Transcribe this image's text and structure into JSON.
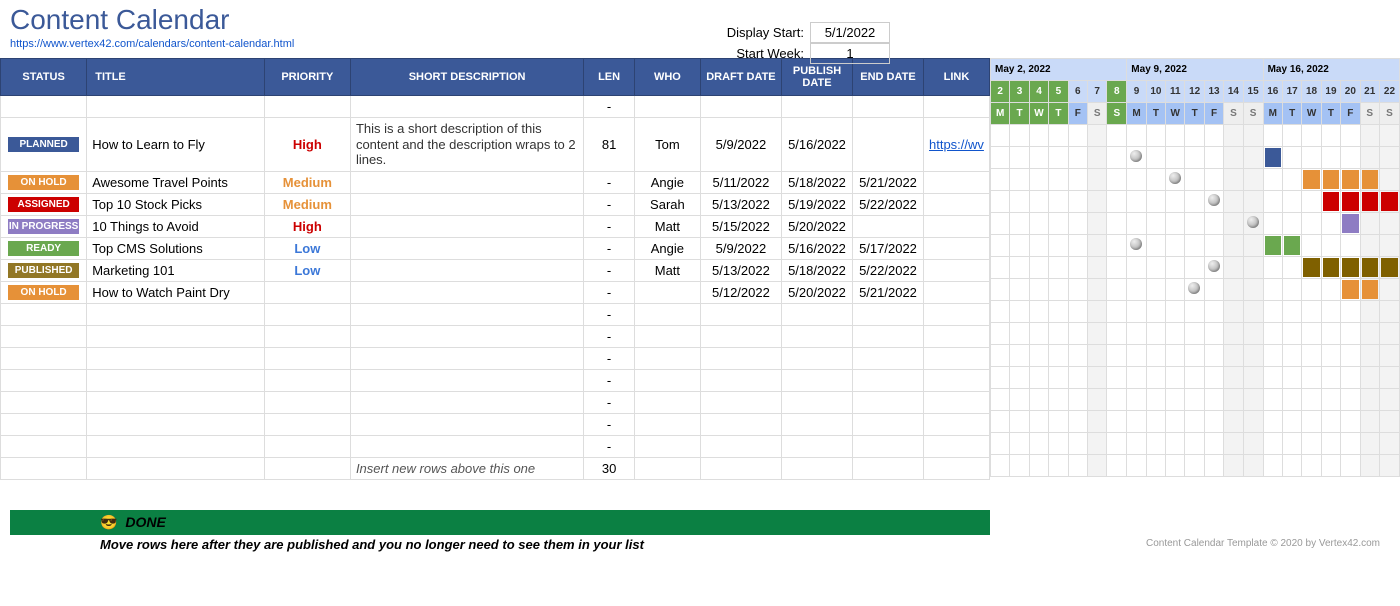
{
  "title": "Content Calendar",
  "source_url": "https://www.vertex42.com/calendars/content-calendar.html",
  "controls": {
    "display_start_label": "Display Start:",
    "display_start_value": "5/1/2022",
    "start_week_label": "Start Week:",
    "start_week_value": "1"
  },
  "columns": {
    "status": "STATUS",
    "title": "TITLE",
    "priority": "PRIORITY",
    "short_desc": "SHORT DESCRIPTION",
    "len": "LEN",
    "who": "WHO",
    "draft_date": "DRAFT DATE",
    "publish_date": "PUBLISH DATE",
    "end_date": "END DATE",
    "link": "LINK"
  },
  "rows": [
    {
      "status": "PLANNED",
      "status_cls": "planned",
      "title": "How to Learn to Fly",
      "priority": "High",
      "pri_cls": "high",
      "desc": "This is a short description of this content and the description wraps to 2 lines.",
      "len": "81",
      "who": "Tom",
      "draft": "5/9/2022",
      "publish": "5/16/2022",
      "end": "",
      "link": "https://wv"
    },
    {
      "status": "ON HOLD",
      "status_cls": "onhold",
      "title": "Awesome Travel Points",
      "priority": "Medium",
      "pri_cls": "medium",
      "desc": "",
      "len": "-",
      "who": "Angie",
      "draft": "5/11/2022",
      "publish": "5/18/2022",
      "end": "5/21/2022",
      "link": ""
    },
    {
      "status": "ASSIGNED",
      "status_cls": "assigned",
      "title": "Top 10 Stock Picks",
      "priority": "Medium",
      "pri_cls": "medium",
      "desc": "",
      "len": "-",
      "who": "Sarah",
      "draft": "5/13/2022",
      "publish": "5/19/2022",
      "end": "5/22/2022",
      "link": ""
    },
    {
      "status": "IN PROGRESS",
      "status_cls": "inprogress",
      "title": "10 Things to Avoid",
      "priority": "High",
      "pri_cls": "high",
      "desc": "",
      "len": "-",
      "who": "Matt",
      "draft": "5/15/2022",
      "publish": "5/20/2022",
      "end": "",
      "link": ""
    },
    {
      "status": "READY",
      "status_cls": "ready",
      "title": "Top CMS Solutions",
      "priority": "Low",
      "pri_cls": "low",
      "desc": "",
      "len": "-",
      "who": "Angie",
      "draft": "5/9/2022",
      "publish": "5/16/2022",
      "end": "5/17/2022",
      "link": ""
    },
    {
      "status": "PUBLISHED",
      "status_cls": "published",
      "title": "Marketing 101",
      "priority": "Low",
      "pri_cls": "low",
      "desc": "",
      "len": "-",
      "who": "Matt",
      "draft": "5/13/2022",
      "publish": "5/18/2022",
      "end": "5/22/2022",
      "link": ""
    },
    {
      "status": "ON HOLD",
      "status_cls": "onhold",
      "title": "How to Watch Paint Dry",
      "priority": "",
      "pri_cls": "",
      "desc": "",
      "len": "-",
      "who": "",
      "draft": "5/12/2022",
      "publish": "5/20/2022",
      "end": "5/21/2022",
      "link": ""
    }
  ],
  "empty_rows": 7,
  "insert_hint": "Insert new rows above this one",
  "insert_len": "30",
  "gantt": {
    "weeks": [
      "May 2, 2022",
      "May 9, 2022",
      "May 16, 2022"
    ],
    "days": [
      {
        "n": "2",
        "dow": "M",
        "green": true
      },
      {
        "n": "3",
        "dow": "T",
        "green": true
      },
      {
        "n": "4",
        "dow": "W",
        "green": true
      },
      {
        "n": "5",
        "dow": "T",
        "green": true
      },
      {
        "n": "6",
        "dow": "F"
      },
      {
        "n": "7",
        "dow": "S",
        "wk": true
      },
      {
        "n": "8",
        "dow": "S",
        "green": true
      },
      {
        "n": "9",
        "dow": "M"
      },
      {
        "n": "10",
        "dow": "T"
      },
      {
        "n": "11",
        "dow": "W"
      },
      {
        "n": "12",
        "dow": "T"
      },
      {
        "n": "13",
        "dow": "F"
      },
      {
        "n": "14",
        "dow": "S",
        "wk": true
      },
      {
        "n": "15",
        "dow": "S",
        "wk": true
      },
      {
        "n": "16",
        "dow": "M"
      },
      {
        "n": "17",
        "dow": "T"
      },
      {
        "n": "18",
        "dow": "W"
      },
      {
        "n": "19",
        "dow": "T"
      },
      {
        "n": "20",
        "dow": "F"
      },
      {
        "n": "21",
        "dow": "S",
        "wk": true
      },
      {
        "n": "22",
        "dow": "S",
        "wk": true
      }
    ],
    "rows": [
      [],
      [
        {
          "c": 7,
          "dot": "lt"
        },
        {
          "c": 14,
          "dot": "blk"
        },
        {
          "c": 14,
          "bar": "planned"
        }
      ],
      [
        {
          "c": 9,
          "dot": "lt"
        },
        {
          "c": 16,
          "dot": "blk"
        },
        {
          "c": 16,
          "bar": "onhold"
        },
        {
          "c": 17,
          "bar": "onhold"
        },
        {
          "c": 18,
          "bar": "onhold"
        },
        {
          "c": 19,
          "bar": "onhold"
        }
      ],
      [
        {
          "c": 11,
          "dot": "lt"
        },
        {
          "c": 17,
          "dot": "blk"
        },
        {
          "c": 17,
          "bar": "assigned"
        },
        {
          "c": 18,
          "bar": "assigned"
        },
        {
          "c": 19,
          "bar": "assigned"
        },
        {
          "c": 20,
          "bar": "assigned"
        }
      ],
      [
        {
          "c": 13,
          "dot": "lt"
        },
        {
          "c": 18,
          "bar": "inprogress"
        }
      ],
      [
        {
          "c": 7,
          "dot": "lt"
        },
        {
          "c": 14,
          "dot": "blk"
        },
        {
          "c": 14,
          "bar": "ready"
        },
        {
          "c": 15,
          "bar": "ready"
        }
      ],
      [
        {
          "c": 11,
          "dot": "lt"
        },
        {
          "c": 16,
          "dot": "blk"
        },
        {
          "c": 16,
          "bar": "published"
        },
        {
          "c": 17,
          "bar": "published"
        },
        {
          "c": 18,
          "bar": "published"
        },
        {
          "c": 19,
          "bar": "published"
        },
        {
          "c": 20,
          "bar": "published"
        }
      ],
      [
        {
          "c": 10,
          "dot": "lt"
        },
        {
          "c": 18,
          "dot": "blk"
        },
        {
          "c": 18,
          "bar": "onhold"
        },
        {
          "c": 19,
          "bar": "onhold"
        }
      ]
    ]
  },
  "done": {
    "label": "DONE",
    "hint": "Move rows here after they are published and you no longer need to see them in your list",
    "copyright": "Content Calendar Template © 2020 by Vertex42.com"
  }
}
